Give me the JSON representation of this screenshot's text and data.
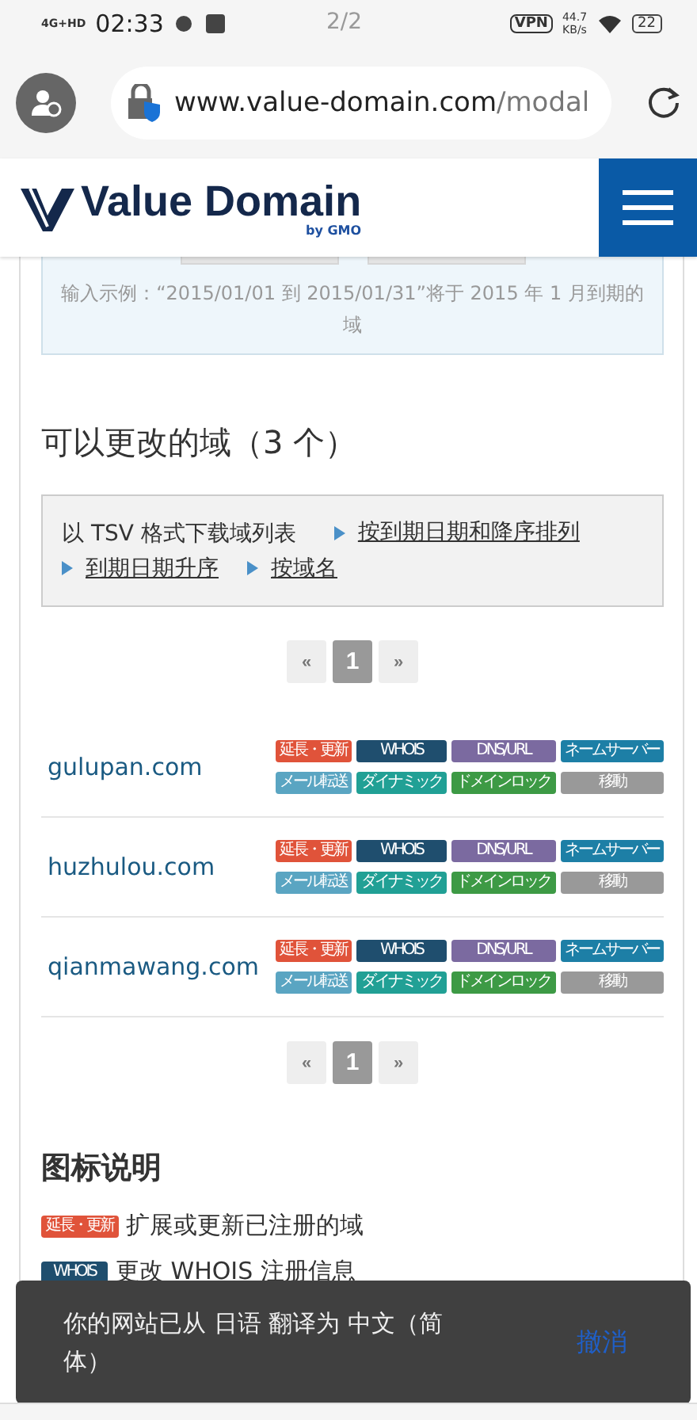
{
  "status_bar": {
    "network": "4G+HD",
    "time": "02:33",
    "vpn": "VPN",
    "speed_value": "44.7",
    "speed_unit": "KB/s",
    "battery": "22"
  },
  "page_indicator": "2/2",
  "browser": {
    "url_host": "www.value-domain.com",
    "url_path": "/modal"
  },
  "site_header": {
    "logo": "Value Domain",
    "logo_sub": "by GMO"
  },
  "search_hint": "输入示例：“2015/01/01 到 2015/01/31”将于 2015 年 1 月到期的域",
  "domains_heading": "可以更改的域（3 个）",
  "download": {
    "label": "以 TSV 格式下载域列表",
    "links": [
      "按到期日期和降序排列",
      "到期日期升序",
      "按域名"
    ]
  },
  "pagination_top": [
    {
      "label": "«",
      "selected": false
    },
    {
      "label": "1",
      "selected": true
    },
    {
      "label": "»",
      "selected": false
    }
  ],
  "domains": [
    {
      "name": "gulupan.com",
      "badges": [
        {
          "label": "延長・更新",
          "color": "#e0533a"
        },
        {
          "label": "WHOIS",
          "color": "#1f4e6e"
        },
        {
          "label": "DNS/URL",
          "color": "#7b6aa0"
        },
        {
          "label": "ネームサーバー",
          "color": "#1d7fa6"
        },
        {
          "label": "メール転送",
          "color": "#5aa5c2"
        },
        {
          "label": "ダイナミック",
          "color": "#21a095"
        },
        {
          "label": "ドメインロック",
          "color": "#3d9a45"
        },
        {
          "label": "移動",
          "color": "#999999"
        }
      ]
    },
    {
      "name": "huzhulou.com",
      "badges": [
        {
          "label": "延長・更新",
          "color": "#e0533a"
        },
        {
          "label": "WHOIS",
          "color": "#1f4e6e"
        },
        {
          "label": "DNS/URL",
          "color": "#7b6aa0"
        },
        {
          "label": "ネームサーバー",
          "color": "#1d7fa6"
        },
        {
          "label": "メール転送",
          "color": "#5aa5c2"
        },
        {
          "label": "ダイナミック",
          "color": "#21a095"
        },
        {
          "label": "ドメインロック",
          "color": "#3d9a45"
        },
        {
          "label": "移動",
          "color": "#999999"
        }
      ]
    },
    {
      "name": "qianmawang.com",
      "badges": [
        {
          "label": "延長・更新",
          "color": "#e0533a"
        },
        {
          "label": "WHOIS",
          "color": "#1f4e6e"
        },
        {
          "label": "DNS/URL",
          "color": "#7b6aa0"
        },
        {
          "label": "ネームサーバー",
          "color": "#1d7fa6"
        },
        {
          "label": "メール転送",
          "color": "#5aa5c2"
        },
        {
          "label": "ダイナミック",
          "color": "#21a095"
        },
        {
          "label": "ドメインロック",
          "color": "#3d9a45"
        },
        {
          "label": "移動",
          "color": "#999999"
        }
      ]
    }
  ],
  "pagination_bottom": [
    {
      "label": "«",
      "selected": false
    },
    {
      "label": "1",
      "selected": true
    },
    {
      "label": "»",
      "selected": false
    }
  ],
  "legend": {
    "title": "图标说明",
    "items": [
      {
        "badge": {
          "label": "延長・更新",
          "color": "#e0533a"
        },
        "text": "扩展或更新已注册的域"
      },
      {
        "badge": {
          "label": "WHOIS",
          "color": "#1f4e6e"
        },
        "text": "更改 WHOIS 注册信息"
      }
    ]
  },
  "toast": {
    "message": "你的网站已从 日语 翻译为 中文（简体）",
    "action": "撤消"
  }
}
